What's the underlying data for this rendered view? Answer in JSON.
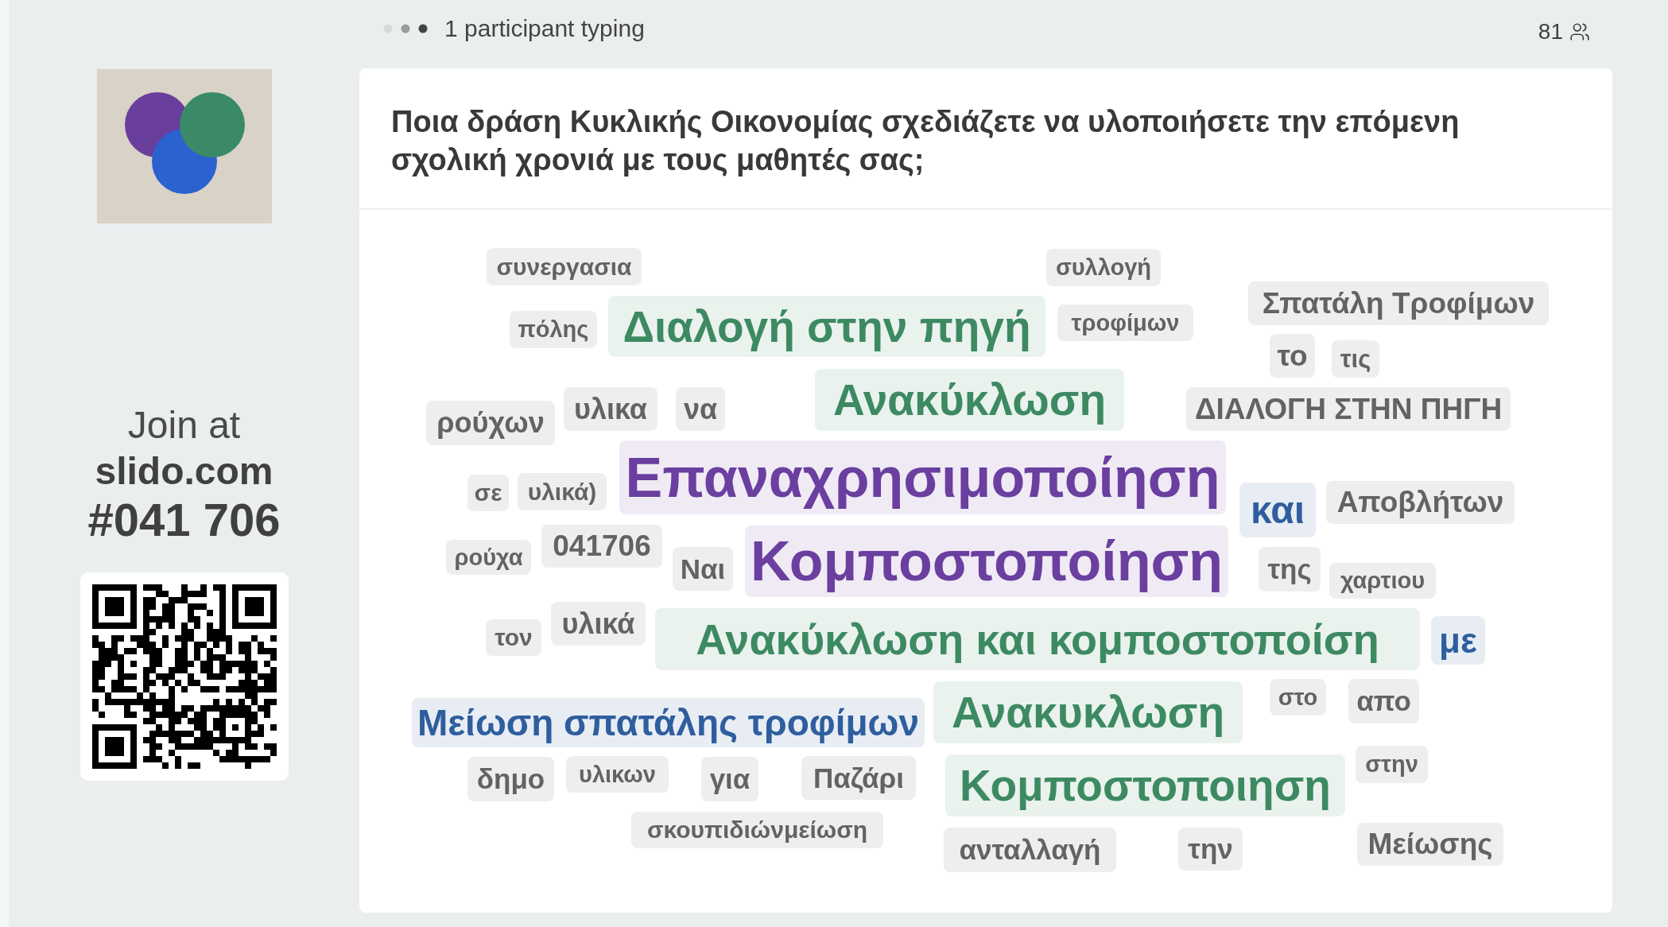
{
  "typing_indicator": {
    "text": "1 participant typing"
  },
  "participants": {
    "count": "81"
  },
  "sidebar": {
    "join_label": "Join at",
    "site": "slido.com",
    "code": "#041 706"
  },
  "poll": {
    "question": "Ποια δράση Κυκλικής Οικονομίας σχεδιάζετε να υλοποιήσετε την επόμενη σχολική χρονιά με τους μαθητές σας;",
    "words": [
      {
        "text": "συνεργασια",
        "color": "#636363"
      },
      {
        "text": "συλλογή",
        "color": "#636363"
      },
      {
        "text": "πόλης",
        "color": "#636363"
      },
      {
        "text": "Διαλογή στην πηγή",
        "color": "#3d8a62"
      },
      {
        "text": "τροφίμων",
        "color": "#636363"
      },
      {
        "text": "Σπατάλη Τροφίμων",
        "color": "#636363"
      },
      {
        "text": "το",
        "color": "#636363"
      },
      {
        "text": "τις",
        "color": "#636363"
      },
      {
        "text": "ρούχων",
        "color": "#636363"
      },
      {
        "text": "υλικα",
        "color": "#636363"
      },
      {
        "text": "να",
        "color": "#636363"
      },
      {
        "text": "Ανακύκλωση",
        "color": "#3d8a62"
      },
      {
        "text": "ΔΙΑΛΟΓΗ ΣΤΗΝ ΠΗΓΗ",
        "color": "#636363"
      },
      {
        "text": "σε",
        "color": "#636363"
      },
      {
        "text": "υλικά)",
        "color": "#636363"
      },
      {
        "text": "Επαναχρησιμοποίηση",
        "color": "#6a3f9f"
      },
      {
        "text": "και",
        "color": "#2f5e9e"
      },
      {
        "text": "Αποβλήτων",
        "color": "#636363"
      },
      {
        "text": "ρούχα",
        "color": "#636363"
      },
      {
        "text": "041706",
        "color": "#636363"
      },
      {
        "text": "Ναι",
        "color": "#636363"
      },
      {
        "text": "Κομποστοποίηση",
        "color": "#6a3f9f"
      },
      {
        "text": "της",
        "color": "#636363"
      },
      {
        "text": "χαρτιου",
        "color": "#636363"
      },
      {
        "text": "τον",
        "color": "#636363"
      },
      {
        "text": "υλικά",
        "color": "#636363"
      },
      {
        "text": "Ανακύκλωση και κομποστοποίση",
        "color": "#3d8a62"
      },
      {
        "text": "με",
        "color": "#2f5e9e"
      },
      {
        "text": "Μείωση σπατάλης τροφίμων",
        "color": "#2f5e9e"
      },
      {
        "text": "Ανακυκλωση",
        "color": "#3d8a62"
      },
      {
        "text": "στο",
        "color": "#636363"
      },
      {
        "text": "απο",
        "color": "#636363"
      },
      {
        "text": "δημο",
        "color": "#636363"
      },
      {
        "text": "υλικων",
        "color": "#636363"
      },
      {
        "text": "για",
        "color": "#636363"
      },
      {
        "text": "Παζάρι",
        "color": "#636363"
      },
      {
        "text": "Κομποστοποιηση",
        "color": "#3d8a62"
      },
      {
        "text": "στην",
        "color": "#636363"
      },
      {
        "text": "σκουπιδιώνμείωση",
        "color": "#636363"
      },
      {
        "text": "ανταλλαγή",
        "color": "#636363"
      },
      {
        "text": "την",
        "color": "#636363"
      },
      {
        "text": "Μείωσης",
        "color": "#636363"
      }
    ]
  }
}
